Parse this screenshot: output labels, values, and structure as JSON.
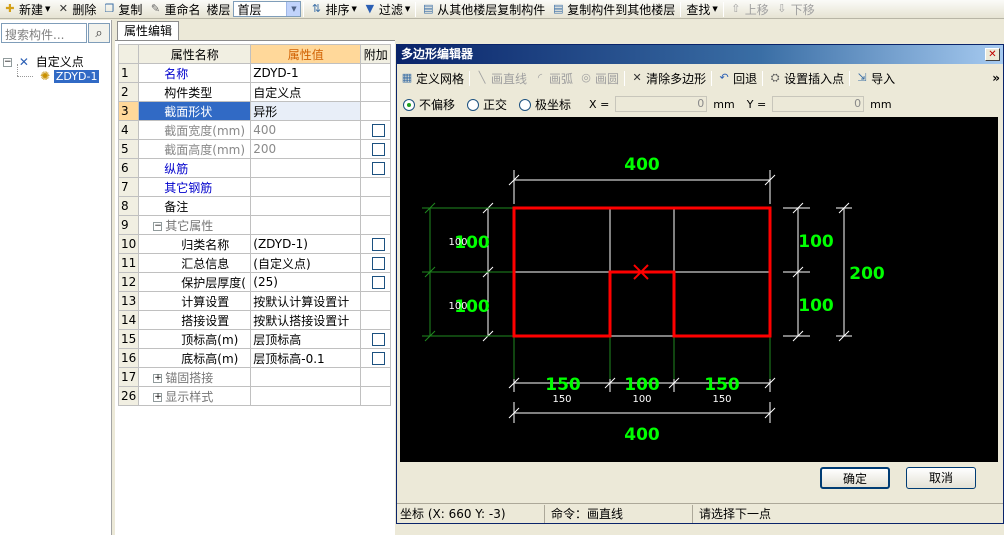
{
  "toolbar": {
    "new": "新建",
    "delete": "删除",
    "copy": "复制",
    "rename": "重命名",
    "floor_label": "楼层",
    "floor_value": "首层",
    "sort": "排序",
    "filter": "过滤",
    "copy_from_other_floor": "从其他楼层复制构件",
    "copy_to_other_floor": "复制构件到其他楼层",
    "find": "查找",
    "move_up": "上移",
    "move_down": "下移"
  },
  "tree": {
    "search_placeholder": "搜索构件...",
    "root": "自定义点",
    "child": "ZDYD-1"
  },
  "properties": {
    "tab": "属性编辑",
    "headers": {
      "name": "属性名称",
      "value": "属性值",
      "extra": "附加"
    },
    "rows": [
      {
        "num": "1",
        "name": "名称",
        "value": "ZDYD-1"
      },
      {
        "num": "2",
        "name": "构件类型",
        "value": "自定义点"
      },
      {
        "num": "3",
        "name": "截面形状",
        "value": "异形"
      },
      {
        "num": "4",
        "name": "截面宽度(mm)",
        "value": "400"
      },
      {
        "num": "5",
        "name": "截面高度(mm)",
        "value": "200"
      },
      {
        "num": "6",
        "name": "纵筋",
        "value": ""
      },
      {
        "num": "7",
        "name": "其它钢筋",
        "value": ""
      },
      {
        "num": "8",
        "name": "备注",
        "value": ""
      },
      {
        "num": "9",
        "name": "其它属性",
        "value": ""
      },
      {
        "num": "10",
        "name": "归类名称",
        "value": "(ZDYD-1)"
      },
      {
        "num": "11",
        "name": "汇总信息",
        "value": "(自定义点)"
      },
      {
        "num": "12",
        "name": "保护层厚度(",
        "value": "(25)"
      },
      {
        "num": "13",
        "name": "计算设置",
        "value": "按默认计算设置计"
      },
      {
        "num": "14",
        "name": "搭接设置",
        "value": "按默认搭接设置计"
      },
      {
        "num": "15",
        "name": "顶标高(m)",
        "value": "层顶标高"
      },
      {
        "num": "16",
        "name": "底标高(m)",
        "value": "层顶标高-0.1"
      },
      {
        "num": "17",
        "name": "锚固搭接",
        "value": ""
      },
      {
        "num": "26",
        "name": "显示样式",
        "value": ""
      }
    ]
  },
  "dialog": {
    "title": "多边形编辑器",
    "tools": {
      "define_grid": "定义网格",
      "draw_line": "画直线",
      "draw_arc": "画弧",
      "draw_circle": "画圆",
      "clear_polygon": "清除多边形",
      "undo": "回退",
      "set_insert_point": "设置插入点",
      "import": "导入",
      "more": "»"
    },
    "options": {
      "no_offset": "不偏移",
      "orthogonal": "正交",
      "polar": "极坐标",
      "x_label": "X =",
      "x_value": "0",
      "y_label": "Y =",
      "y_value": "0",
      "unit": "mm"
    },
    "canvas": {
      "top_dim": "400",
      "bottom_dim": "400",
      "right_dim_upper": "100",
      "right_dim_lower": "100",
      "right_total": "200",
      "left_dim_upper": "100",
      "left_dim_lower": "100",
      "left_grid_upper": "100",
      "left_grid_lower": "100",
      "bottom_seg_1": "150",
      "bottom_seg_2": "100",
      "bottom_seg_3": "150",
      "bottom_grid_1": "150",
      "bottom_grid_2": "100",
      "bottom_grid_3": "150",
      "shape_color": "#ff0000",
      "dim_color": "#00ff00"
    },
    "ok": "确定",
    "cancel": "取消",
    "status": {
      "coord": "坐标 (X: 660 Y: -3)",
      "command": "命令：画直线",
      "prompt": "请选择下一点"
    }
  }
}
